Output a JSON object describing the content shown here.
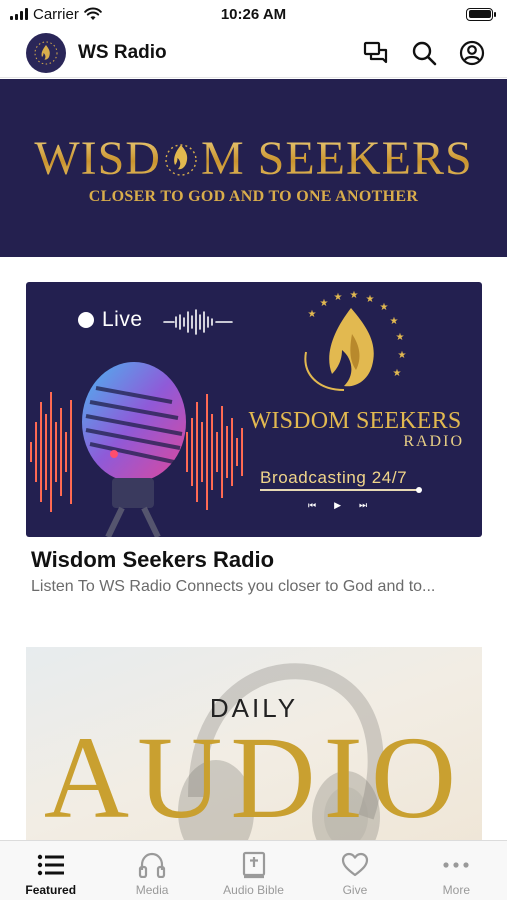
{
  "status_bar": {
    "carrier": "Carrier",
    "time": "10:26 AM"
  },
  "header": {
    "title": "WS Radio"
  },
  "hero": {
    "title_part1": "WISD",
    "title_part2": "M SEEKERS",
    "subtitle": "CLOSER TO GOD AND TO ONE ANOTHER"
  },
  "radio_card": {
    "live_label": "Live",
    "brand": "WISDOM SEEKERS",
    "brand_sub": "RADIO",
    "broadcast": "Broadcasting 24/7",
    "title": "Wisdom Seekers Radio",
    "description": "Listen To WS Radio Connects you closer to God and to..."
  },
  "audio_card": {
    "daily": "DAILY",
    "word": "AUDIO"
  },
  "tabs": [
    {
      "label": "Featured",
      "icon": "list-icon",
      "active": true
    },
    {
      "label": "Media",
      "icon": "headphones-icon",
      "active": false
    },
    {
      "label": "Audio Bible",
      "icon": "bible-icon",
      "active": false
    },
    {
      "label": "Give",
      "icon": "heart-icon",
      "active": false
    },
    {
      "label": "More",
      "icon": "more-icon",
      "active": false
    }
  ],
  "colors": {
    "navy": "#24204f",
    "gold": "#d8ae4c",
    "tab_inactive": "#9a9a9a"
  }
}
